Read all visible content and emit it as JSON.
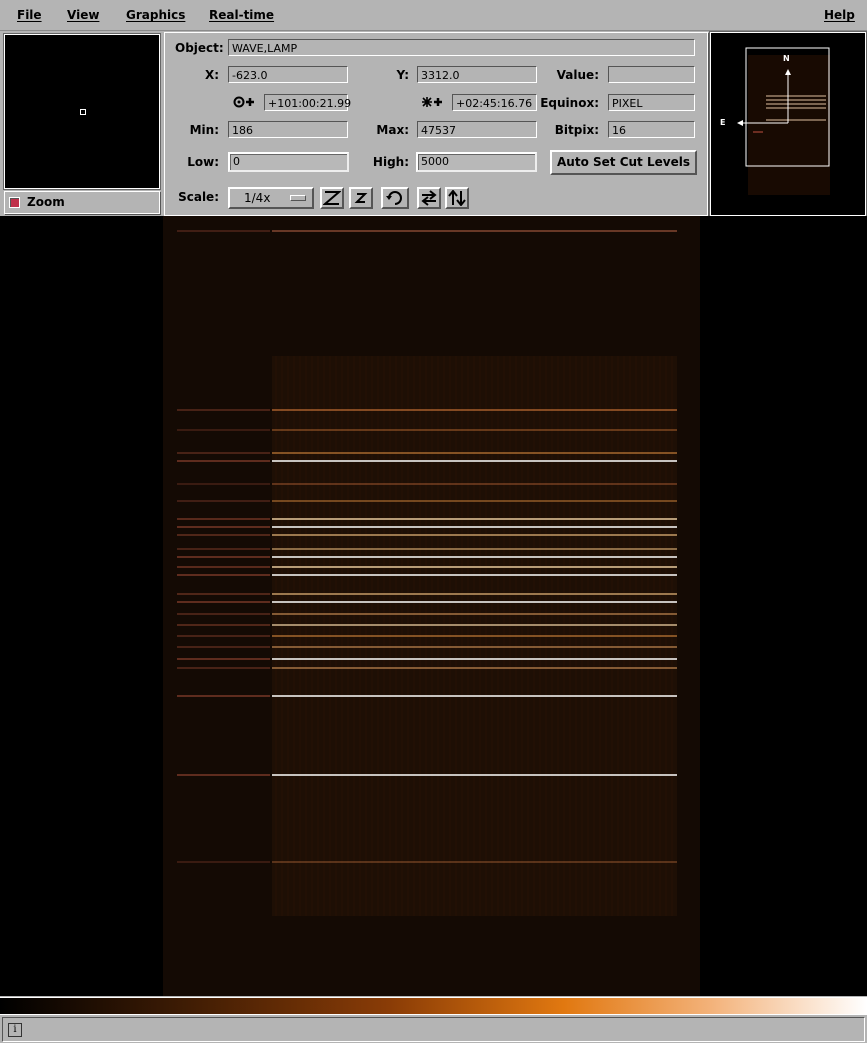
{
  "menubar": {
    "file": "File",
    "view": "View",
    "graphics": "Graphics",
    "realtime": "Real-time",
    "help": "Help"
  },
  "zoom": {
    "toggle_label": "Zoom",
    "toggle_checked": true
  },
  "info": {
    "object_label": "Object:",
    "object_value": "WAVE,LAMP",
    "x_label": "X:",
    "x_value": "-623.0",
    "y_label": "Y:",
    "y_value": "3312.0",
    "value_label": "Value:",
    "value_value": "",
    "ra_icon": "alpha-plus-icon",
    "ra_value": "+101:00:21.99",
    "dec_icon": "delta-plus-icon",
    "dec_value": "+02:45:16.76",
    "equinox_label": "Equinox:",
    "equinox_value": "PIXEL",
    "min_label": "Min:",
    "min_value": "186",
    "max_label": "Max:",
    "max_value": "47537",
    "bitpix_label": "Bitpix:",
    "bitpix_value": "16",
    "low_label": "Low:",
    "low_value": "0",
    "high_label": "High:",
    "high_value": "5000",
    "auto_cut_label": "Auto Set Cut Levels",
    "scale_label": "Scale:",
    "scale_value": "1/4x"
  },
  "toolbar_icons": [
    "zoom-in-icon",
    "zoom-out-icon",
    "rotate-icon",
    "flip-x-icon",
    "flip-y-icon"
  ],
  "pan": {
    "north_label": "N",
    "east_label": "E"
  },
  "colormap": {
    "name": "heat",
    "colors": [
      "#000000",
      "#8a3c06",
      "#e17810",
      "#ffffff"
    ]
  },
  "status": {
    "icon": "info-icon",
    "text": ""
  }
}
